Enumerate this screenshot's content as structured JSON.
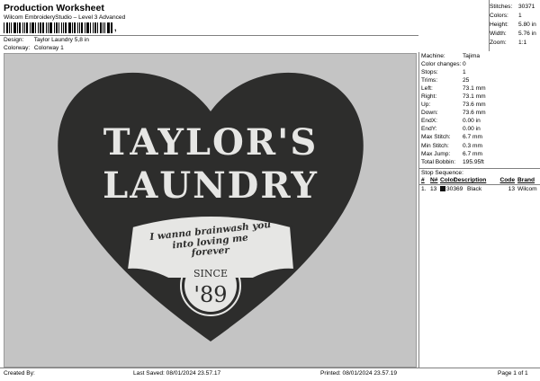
{
  "header": {
    "title": "Production Worksheet",
    "subtitle": "Wilcom EmbroideryStudio – Level 3 Advanced",
    "barcode_mark": ",",
    "design_label": "Design:",
    "design_value": "Taylor Laundry 5,8 in",
    "colorway_label": "Colorway:",
    "colorway_value": "Colorway 1"
  },
  "summary": [
    {
      "label": "Stitches:",
      "value": "30371"
    },
    {
      "label": "Colors:",
      "value": "1"
    },
    {
      "label": "Height:",
      "value": "5.80 in"
    },
    {
      "label": "Width:",
      "value": "5.76 in"
    },
    {
      "label": "Zoom:",
      "value": "1:1"
    }
  ],
  "design": {
    "line1": "TAYLOR'S",
    "line2": "LAUNDRY",
    "banner_line1": "I wanna brainwash you",
    "banner_line2": "into loving me",
    "banner_line3": "forever",
    "since": "SINCE",
    "year": "'89",
    "heart_color": "#2d2d2c",
    "text_color": "#e6e6e4"
  },
  "machine_info": [
    {
      "label": "Machine:",
      "value": "Tajima"
    },
    {
      "label": "Color changes:",
      "value": "0"
    },
    {
      "label": "Stops:",
      "value": "1"
    },
    {
      "label": "Trims:",
      "value": "25"
    },
    {
      "label": "Left:",
      "value": "73.1 mm"
    },
    {
      "label": "Right:",
      "value": "73.1 mm"
    },
    {
      "label": "Up:",
      "value": "73.6 mm"
    },
    {
      "label": "Down:",
      "value": "73.6 mm"
    },
    {
      "label": "EndX:",
      "value": "0.00 in"
    },
    {
      "label": "EndY:",
      "value": "0.00 in"
    },
    {
      "label": "Max Stitch:",
      "value": "6.7 mm"
    },
    {
      "label": "Min Stitch:",
      "value": "0.3 mm"
    },
    {
      "label": "Max Jump:",
      "value": "6.7 mm"
    },
    {
      "label": "Total Bobbin:",
      "value": "195.95ft"
    }
  ],
  "stop_sequence": {
    "title": "Stop Sequence:",
    "headers": [
      "#",
      "N#",
      "Color",
      "Description",
      "Code",
      "Brand"
    ],
    "rows": [
      {
        "num": "1.",
        "n": "13",
        "color": "30369",
        "description": "Black",
        "code": "13",
        "brand": "Wilcom",
        "swatch": "#111111"
      }
    ]
  },
  "footer": {
    "created_by": "Created By:",
    "last_saved": "Last Saved: 08/01/2024 23.57.17",
    "printed": "Printed: 08/01/2024 23.57.19",
    "page": "Page 1 of 1"
  }
}
